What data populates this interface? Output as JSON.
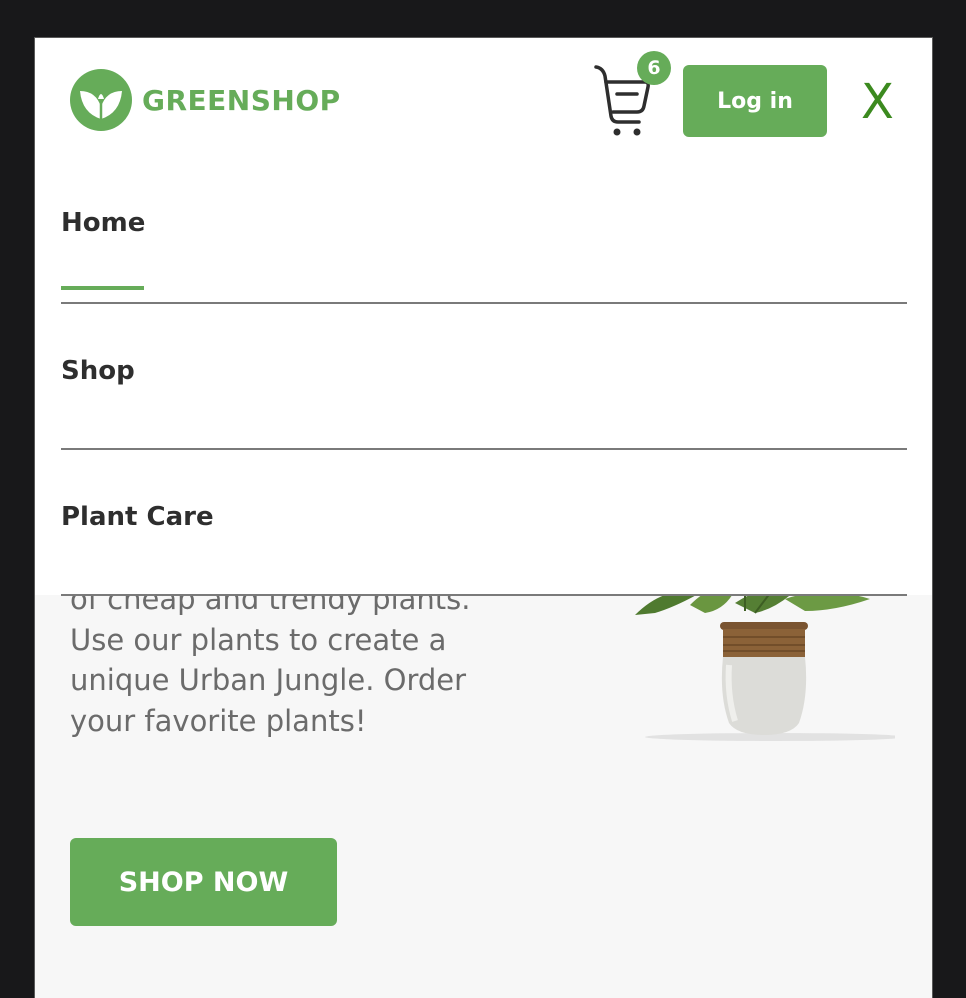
{
  "header": {
    "brand": "GREENSHOP",
    "cart_count": "6",
    "login_label": "Log in",
    "close_label": "X"
  },
  "nav": {
    "items": [
      {
        "label": "Home",
        "active": true
      },
      {
        "label": "Shop",
        "active": false
      },
      {
        "label": "Plant Care",
        "active": false
      }
    ]
  },
  "hero": {
    "description": "of cheap and trendy plants. Use our plants to create a unique Urban Jungle. Order your favorite plants!",
    "cta_label": "SHOP NOW"
  },
  "colors": {
    "accent": "#66ac59",
    "close": "#3c8a1f",
    "text_dark": "#2e2e2e",
    "text_muted": "#6b6b6b",
    "hero_bg": "#f7f7f7",
    "outer_bg": "#18181a"
  },
  "icons": [
    "leaf-logo-icon",
    "shopping-cart-icon",
    "close-icon",
    "plant-image"
  ]
}
